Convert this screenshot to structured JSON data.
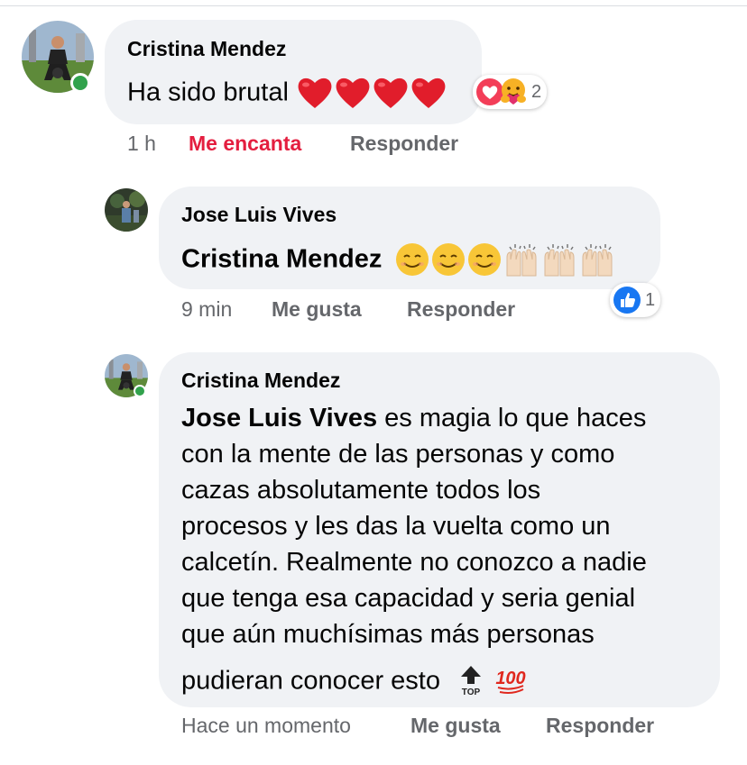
{
  "comment1": {
    "author": "Cristina Mendez",
    "text": "Ha sido brutal",
    "emojis": [
      "heart-icon",
      "heart-icon",
      "heart-icon",
      "heart-icon"
    ],
    "reaction_icons": [
      "love-reaction-icon",
      "care-reaction-icon"
    ],
    "reaction_count": "2",
    "time": "1 h",
    "reaction_label": "Me encanta",
    "reply_label": "Responder"
  },
  "comment2": {
    "author": "Jose Luis Vives",
    "mention": "Cristina Mendez",
    "emojis": [
      "smile-icon",
      "smile-icon",
      "smile-icon",
      "raising-hands-icon",
      "raising-hands-icon",
      "raising-hands-icon"
    ],
    "reaction_icons": [
      "like-reaction-icon"
    ],
    "reaction_count": "1",
    "time": "9 min",
    "like_label": "Me gusta",
    "reply_label": "Responder"
  },
  "comment3": {
    "author": "Cristina Mendez",
    "mention": "Jose Luis Vives",
    "lines": [
      " es magia lo que haces",
      "con la mente de las personas y como",
      "cazas absolutamente todos los",
      "procesos y les das la vuelta como un",
      "calcetín. Realmente no conozco a nadie",
      "que tenga esa capacidad y seria genial",
      "que aún muchísimas más personas",
      "pudieran conocer esto"
    ],
    "emojis": [
      "top-arrow-icon",
      "hundred-points-icon"
    ],
    "time": "Hace un momento",
    "like_label": "Me gusta",
    "reply_label": "Responder"
  },
  "colors": {
    "bubble": "#f0f2f5",
    "meta": "#65676b",
    "love": "#e41e3f",
    "like": "#1877f2",
    "online": "#31a24c"
  }
}
